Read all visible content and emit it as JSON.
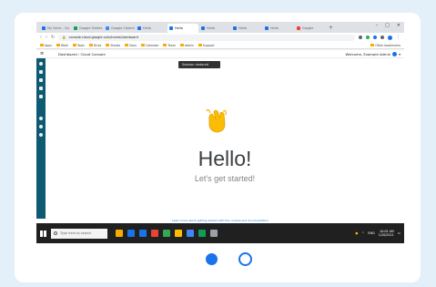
{
  "browser": {
    "tabs": [
      {
        "label": "My Drive - Go",
        "color": "#1a73e8"
      },
      {
        "label": "Google Sheets",
        "color": "#0f9d58"
      },
      {
        "label": "Google Calend",
        "color": "#4285f4"
      },
      {
        "label": "Hello",
        "color": "#1a73e8"
      },
      {
        "label": "Hello",
        "color": "#1a73e8",
        "active": true
      },
      {
        "label": "Hello",
        "color": "#1a73e8"
      },
      {
        "label": "Hello",
        "color": "#1a73e8"
      },
      {
        "label": "Hello",
        "color": "#1a73e8"
      },
      {
        "label": "Google",
        "color": "#ea4335"
      }
    ],
    "new_tab": "+",
    "window_controls": [
      "–",
      "□",
      "✕"
    ],
    "address": {
      "back": "‹",
      "forward": "›",
      "reload": "↻",
      "url": "console.cloud.google.com/home/dashboard"
    },
    "bookmarks": [
      "Apps",
      "Work",
      "Tools",
      "Drive",
      "Sheets",
      "Docs",
      "Calendar",
      "Team",
      "Admin",
      "Support"
    ],
    "other_bookmarks": "Other bookmarks"
  },
  "app": {
    "menu_icon": "≡",
    "breadcrumb": "Dashboard › Cloud Console",
    "user": "Welcome, Example Admin",
    "toast": "Session restored",
    "hello": "Hello!",
    "subtitle": "Let's get started!",
    "footer_link": "Learn more about getting started with the console and documentation"
  },
  "taskbar": {
    "search_placeholder": "Type here to search",
    "apps": [
      "#f9ab00",
      "#1a73e8",
      "#1a73e8",
      "#ea4335",
      "#34a853",
      "#fbbc04",
      "#4285f4",
      "#0f9d58",
      "#9aa0a6"
    ],
    "tray_text": "ENG",
    "time": "10:05 AM",
    "date": "1/20/2021"
  },
  "pager": {
    "pages": 2,
    "current": 1
  },
  "colors": {
    "accent": "#1a73e8",
    "sidebar": "#0e5a73",
    "background": "#e3f0fa"
  }
}
